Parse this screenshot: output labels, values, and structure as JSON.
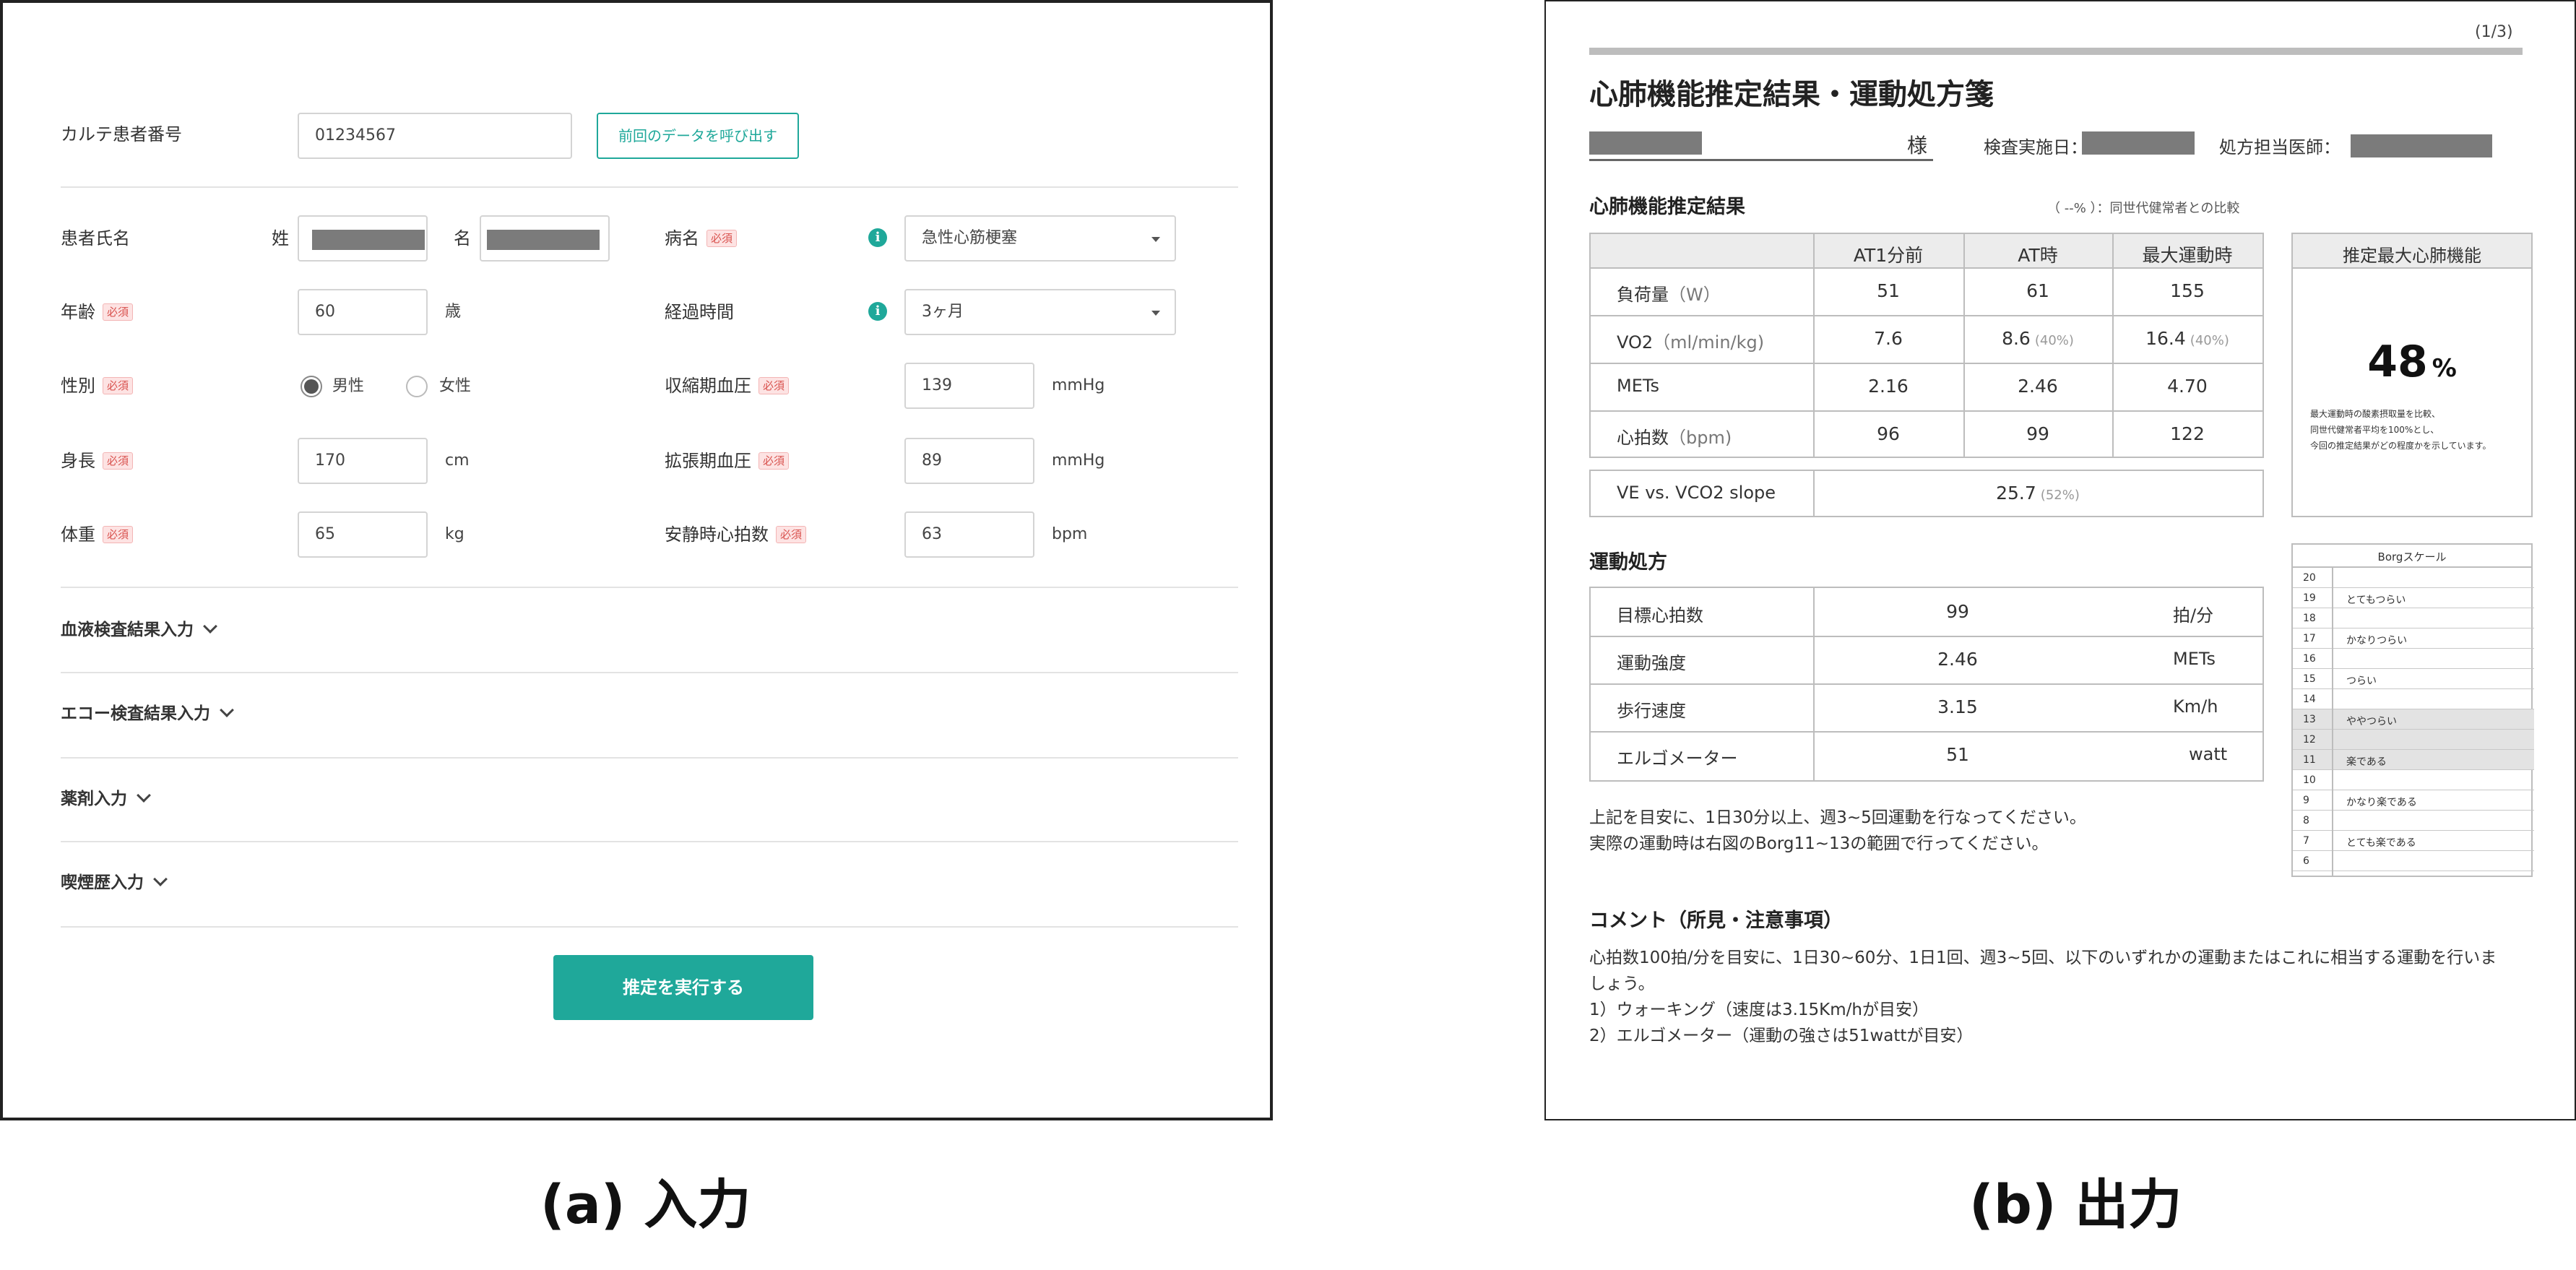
{
  "form": {
    "patient_id_label": "カルテ患者番号",
    "patient_id_value": "01234567",
    "load_previous_button": "前回のデータを呼び出す",
    "required_badge": "必須",
    "name_label": "患者氏名",
    "family_name_label": "姓",
    "given_name_label": "名",
    "disease_label": "病名",
    "disease_value": "急性心筋梗塞",
    "age_label": "年齢",
    "age_value": "60",
    "age_unit": "歳",
    "elapsed_label": "経過時間",
    "elapsed_value": "3ヶ月",
    "sex_label": "性別",
    "sex_options": [
      "男性",
      "女性"
    ],
    "sex_selected": "男性",
    "sbp_label": "収縮期血圧",
    "sbp_value": "139",
    "bp_unit": "mmHg",
    "height_label": "身長",
    "height_value": "170",
    "height_unit": "cm",
    "dbp_label": "拡張期血圧",
    "dbp_value": "89",
    "weight_label": "体重",
    "weight_value": "65",
    "weight_unit": "kg",
    "hr_label": "安静時心拍数",
    "hr_value": "63",
    "hr_unit": "bpm",
    "sections": [
      "血液検査結果入力",
      "エコー検査結果入力",
      "薬剤入力",
      "喫煙歴入力"
    ],
    "submit_button": "推定を実行する",
    "info_icon": "i"
  },
  "report": {
    "page_indicator": "(1/3)",
    "title": "心肺機能推定結果・運動処方箋",
    "honorific": "様",
    "exam_date_label": "検査実施日：",
    "doctor_label": "処方担当医師：",
    "cpx_heading": "心肺機能推定結果",
    "comparison_note": "（ --% ）：同世代健常者との比較",
    "table_headers": [
      "AT1分前",
      "AT時",
      "最大運動時"
    ],
    "table_rows": [
      {
        "label": "負荷量",
        "unit": "（W）",
        "values": [
          "51",
          "61",
          "155"
        ],
        "pcts": [
          "",
          "",
          ""
        ]
      },
      {
        "label": "VO2",
        "unit": "（ml/min/kg)",
        "values": [
          "7.6",
          "8.6",
          "16.4"
        ],
        "pcts": [
          "",
          "(40%)",
          "(40%)"
        ]
      },
      {
        "label": "METs",
        "unit": "",
        "values": [
          "2.16",
          "2.46",
          "4.70"
        ],
        "pcts": [
          "",
          "",
          ""
        ]
      },
      {
        "label": "心拍数",
        "unit": "（bpm)",
        "values": [
          "96",
          "99",
          "122"
        ],
        "pcts": [
          "",
          "",
          ""
        ]
      }
    ],
    "slope_label": "VE vs. VCO2 slope",
    "slope_value": "25.7",
    "slope_pct": "(52%)",
    "max_box_title": "推定最大心肺機能",
    "max_value": "48",
    "max_unit": "%",
    "max_note": [
      "最大運動時の酸素摂取量を比較、",
      "同世代健常者平均を100%とし、",
      "今回の推定結果がどの程度かを示しています。"
    ],
    "rx_heading": "運動処方",
    "rx_rows": [
      {
        "label": "目標心拍数",
        "value": "99",
        "unit": "拍/分"
      },
      {
        "label": "運動強度",
        "value": "2.46",
        "unit": "METs"
      },
      {
        "label": "歩行速度",
        "value": "3.15",
        "unit": "Km/h"
      },
      {
        "label": "エルゴメーター",
        "value": "51",
        "unit": "watt"
      }
    ],
    "rx_note": [
      "上記を目安に、1日30分以上、週3~5回運動を行なってください。",
      "実際の運動時は右図のBorg11~13の範囲で行ってください。"
    ],
    "borg_title": "Borgスケール",
    "borg_rows": [
      {
        "n": "20",
        "w": ""
      },
      {
        "n": "19",
        "w": "とてもつらい"
      },
      {
        "n": "18",
        "w": ""
      },
      {
        "n": "17",
        "w": "かなりつらい"
      },
      {
        "n": "16",
        "w": ""
      },
      {
        "n": "15",
        "w": "つらい"
      },
      {
        "n": "14",
        "w": ""
      },
      {
        "n": "13",
        "w": "ややつらい"
      },
      {
        "n": "12",
        "w": ""
      },
      {
        "n": "11",
        "w": "楽である"
      },
      {
        "n": "10",
        "w": ""
      },
      {
        "n": "9",
        "w": "かなり楽である"
      },
      {
        "n": "8",
        "w": ""
      },
      {
        "n": "7",
        "w": "とても楽である"
      },
      {
        "n": "6",
        "w": ""
      }
    ],
    "borg_shaded": [
      "11",
      "12",
      "13"
    ],
    "comment_heading": "コメント（所見・注意事項）",
    "comment_lines": [
      "心拍数100拍/分を目安に、1日30~60分、1日1回、週3~5回、以下のいずれかの運動またはこれに相当する運動を行いま",
      "しょう。",
      "1）ウォーキング（速度は3.15Km/hが目安）",
      "2）エルゴメーター（運動の強さは51wattが目安）"
    ]
  },
  "captions": {
    "a": "(a) 入力",
    "b": "(b) 出力"
  },
  "colors": {
    "accent": "#1fa89a",
    "required": "#d9534f",
    "redacted": "#7b7b7b"
  }
}
